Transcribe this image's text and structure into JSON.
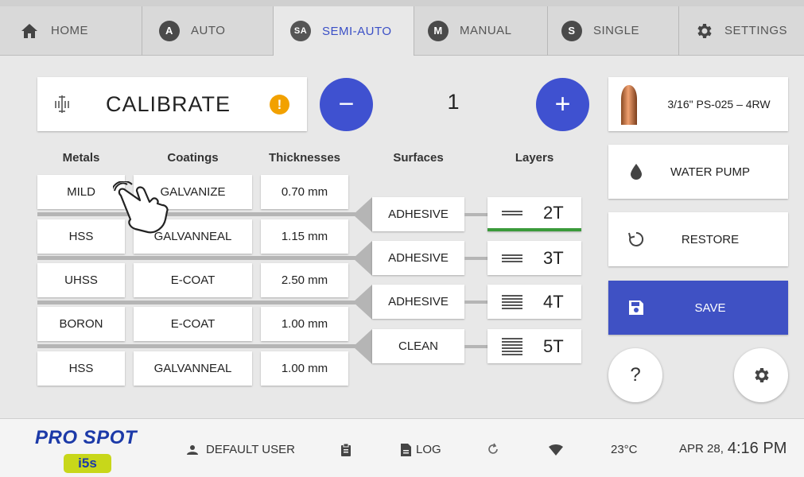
{
  "tabs": [
    {
      "label": "HOME",
      "icon": "home-icon",
      "active": false
    },
    {
      "label": "AUTO",
      "icon": "A",
      "active": false
    },
    {
      "label": "SEMI-AUTO",
      "icon": "SA",
      "active": true
    },
    {
      "label": "MANUAL",
      "icon": "M",
      "active": false
    },
    {
      "label": "SINGLE",
      "icon": "S",
      "active": false
    },
    {
      "label": "SETTINGS",
      "icon": "gear-icon",
      "active": false
    }
  ],
  "calibrate": {
    "label": "CALIBRATE",
    "warning": "!"
  },
  "stepper": {
    "minus": "−",
    "value": "1",
    "plus": "+"
  },
  "columns": {
    "metals": "Metals",
    "coatings": "Coatings",
    "thicknesses": "Thicknesses",
    "surfaces": "Surfaces",
    "layers": "Layers"
  },
  "rows": [
    {
      "metal": "MILD",
      "coating": "GALVANIZE",
      "thickness": "0.70 mm"
    },
    {
      "metal": "HSS",
      "coating": "GALVANNEAL",
      "thickness": "1.15 mm"
    },
    {
      "metal": "UHSS",
      "coating": "E-COAT",
      "thickness": "2.50 mm"
    },
    {
      "metal": "BORON",
      "coating": "E-COAT",
      "thickness": "1.00 mm"
    },
    {
      "metal": "HSS",
      "coating": "GALVANNEAL",
      "thickness": "1.00 mm"
    }
  ],
  "surfaces": [
    "ADHESIVE",
    "ADHESIVE",
    "ADHESIVE",
    "CLEAN"
  ],
  "layers": [
    "2T",
    "3T",
    "4T",
    "5T"
  ],
  "right": {
    "tip": "3/16\" PS-025 – 4RW",
    "water_pump": "WATER PUMP",
    "restore": "RESTORE",
    "save": "SAVE",
    "help": "?"
  },
  "footer": {
    "logo_top": "PRO SPOT",
    "logo_bottom": "i5s",
    "user": "DEFAULT USER",
    "log": "LOG",
    "temp": "23°C",
    "date": "APR 28,",
    "time": "4:16 PM"
  },
  "colors": {
    "accent": "#3f51c4",
    "warning": "#f2a100",
    "selected_layer": "#3a9a3a"
  }
}
